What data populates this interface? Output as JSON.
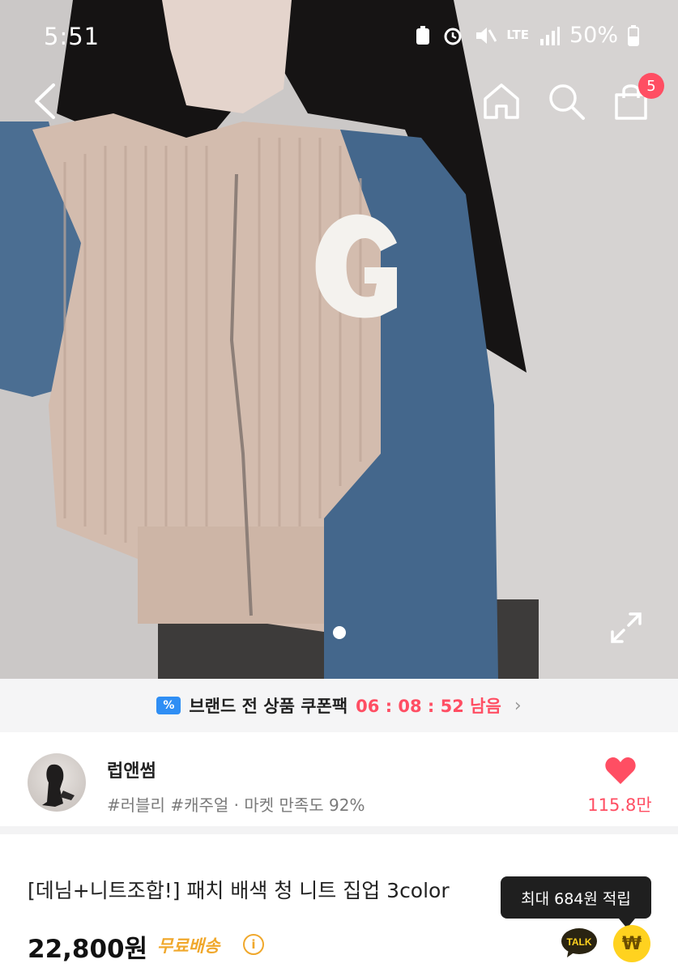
{
  "status_bar": {
    "time": "5:51",
    "network": "LTE",
    "battery": "50%"
  },
  "nav": {
    "cart_count": "5",
    "icons": [
      "back-icon",
      "home-icon",
      "search-icon",
      "cart-icon"
    ]
  },
  "gallery": {
    "image_description_icon": "expand-icon"
  },
  "coupon_bar": {
    "icon": "%",
    "label": "브랜드 전 상품 쿠폰팩",
    "timer": "06 : 08 : 52 남음",
    "chevron": "›"
  },
  "store": {
    "name": "럽앤썸",
    "tags": "#러블리 #캐주얼 · 마켓 만족도 92%",
    "likes": "115.8만"
  },
  "product": {
    "title": "[데님+니트조합!] 패치 배색 청 니트 집업 3color",
    "price": "22,800원",
    "shipping": "무료배송",
    "info_symbol": "i"
  },
  "reward_tooltip": {
    "text": "최대 684원 적립"
  },
  "floating": {
    "talk_label": "TALK",
    "coin_symbol": "₩"
  },
  "colors": {
    "accent_red": "#ff4e63",
    "shipping_orange": "#f0a82c",
    "coupon_blue": "#2f8ef4",
    "coin_yellow": "#ffd21f"
  }
}
